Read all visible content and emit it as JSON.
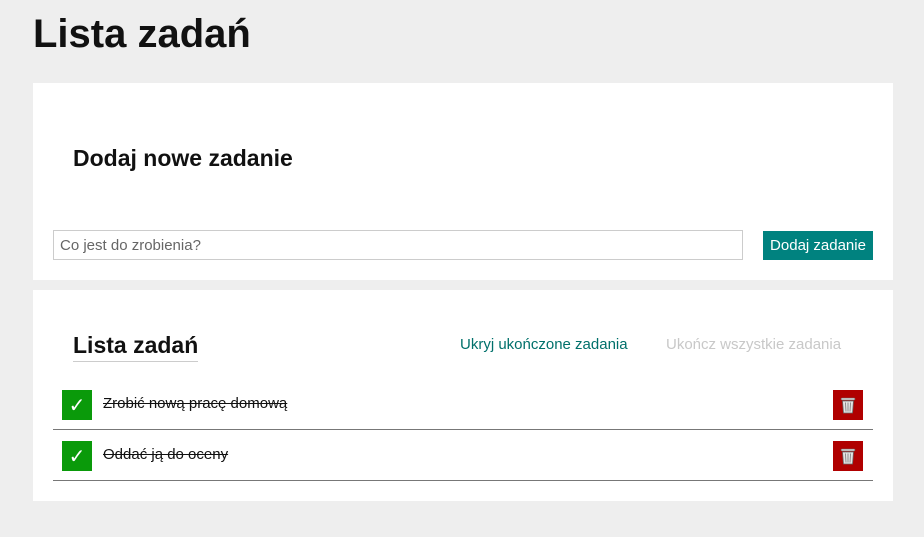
{
  "page": {
    "title": "Lista zadań"
  },
  "add_section": {
    "title": "Dodaj nowe zadanie",
    "input_placeholder": "Co jest do zrobienia?",
    "input_value": "",
    "button_label": "Dodaj zadanie"
  },
  "list_section": {
    "title": "Lista zadań",
    "hide_completed_label": "Ukryj ukończone zadania",
    "complete_all_label": "Ukończ wszystkie zadania",
    "tasks": [
      {
        "text": "Zrobić nową pracę domową",
        "done": true
      },
      {
        "text": "Oddać ją do oceny",
        "done": true
      }
    ]
  },
  "icons": {
    "check": "check-icon",
    "delete": "trash-icon"
  },
  "colors": {
    "accent": "#00827f",
    "link": "#00706b",
    "disabled_link": "#c8c8c8",
    "done": "#0a9a0a",
    "delete": "#b00000"
  }
}
